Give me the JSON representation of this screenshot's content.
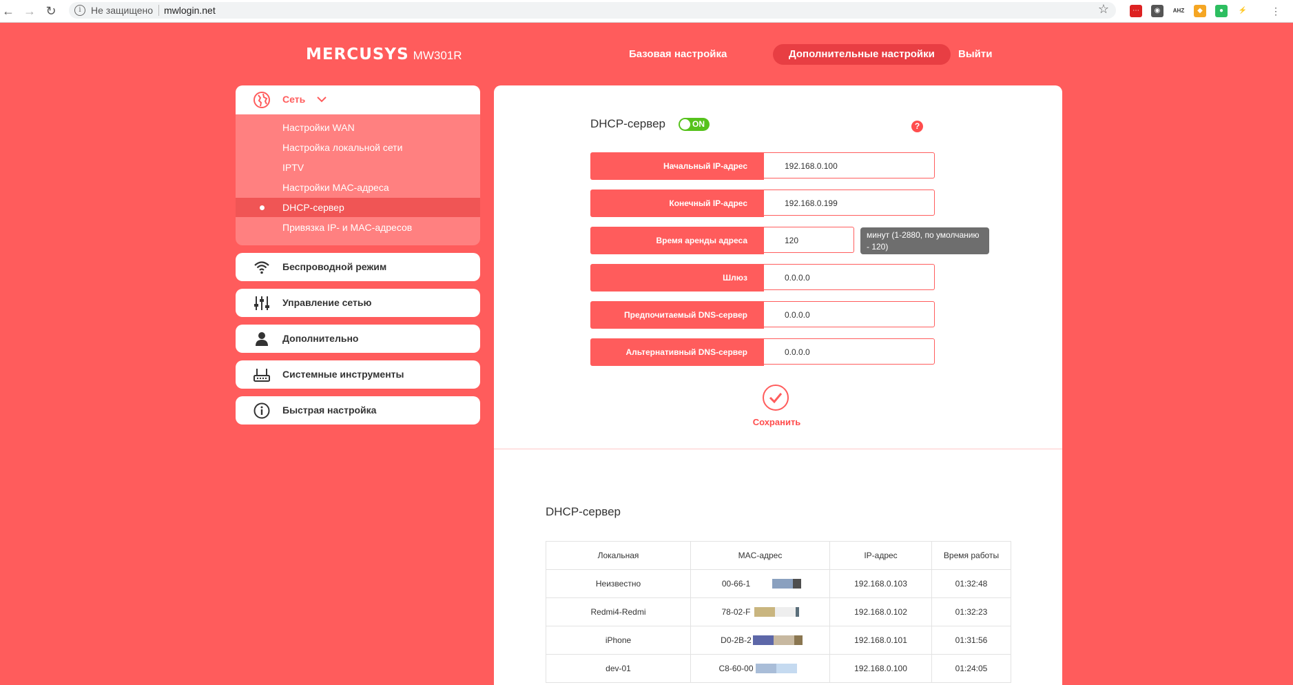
{
  "browser": {
    "security_label": "Не защищено",
    "url": "mwlogin.net"
  },
  "header": {
    "brand": "MERCUSYS",
    "model": "MW301R",
    "nav": {
      "basic": "Базовая настройка",
      "advanced": "Дополнительные настройки",
      "logout": "Выйти"
    }
  },
  "sidebar": {
    "network": {
      "label": "Сеть",
      "items": [
        {
          "label": "Настройки WAN"
        },
        {
          "label": "Настройка локальной сети"
        },
        {
          "label": "IPTV"
        },
        {
          "label": "Настройки MAC-адреса"
        },
        {
          "label": "DHCP-сервер",
          "active": true
        },
        {
          "label": "Привязка IP- и MAC-адресов"
        }
      ]
    },
    "sections": [
      {
        "label": "Беспроводной режим",
        "icon": "wifi-icon"
      },
      {
        "label": "Управление сетью",
        "icon": "sliders-icon"
      },
      {
        "label": "Дополнительно",
        "icon": "user-icon"
      },
      {
        "label": "Системные инструменты",
        "icon": "router-icon"
      },
      {
        "label": "Быстрая настройка",
        "icon": "info-icon"
      }
    ]
  },
  "dhcp_settings": {
    "title": "DHCP-сервер",
    "toggle_state": "ON",
    "help": "?",
    "fields": {
      "start_ip": {
        "label": "Начальный IP-адрес",
        "value": "192.168.0.100"
      },
      "end_ip": {
        "label": "Конечный IP-адрес",
        "value": "192.168.0.199"
      },
      "lease_time": {
        "label": "Время аренды адреса",
        "value": "120"
      },
      "gateway": {
        "label": "Шлюз",
        "value": "0.0.0.0"
      },
      "primary_dns": {
        "label": "Предпочитаемый DNS-сервер",
        "value": "0.0.0.0"
      },
      "alt_dns": {
        "label": "Альтернативный DNS-сервер",
        "value": "0.0.0.0"
      }
    },
    "lease_hint": "минут (1-2880, по умолчанию - 120)",
    "save_label": "Сохранить"
  },
  "client_list": {
    "title": "DHCP-сервер",
    "columns": [
      "Локальная",
      "MAC-адрес",
      "IP-адрес",
      "Время работы"
    ],
    "rows": [
      {
        "name": "Неизвестно",
        "mac": "00-66-1",
        "ip": "192.168.0.103",
        "uptime": "01:32:48"
      },
      {
        "name": "Redmi4-Redmi",
        "mac": "78-02-F",
        "ip": "192.168.0.102",
        "uptime": "01:32:23"
      },
      {
        "name": "iPhone",
        "mac": "D0-2B-2",
        "ip": "192.168.0.101",
        "uptime": "01:31:56"
      },
      {
        "name": "dev-01",
        "mac": "C8-60-00",
        "ip": "192.168.0.100",
        "uptime": "01:24:05"
      }
    ]
  },
  "colors": {
    "brand_red": "#ff5c5c",
    "active_red": "#e83e43",
    "toggle_green": "#56c21c"
  }
}
